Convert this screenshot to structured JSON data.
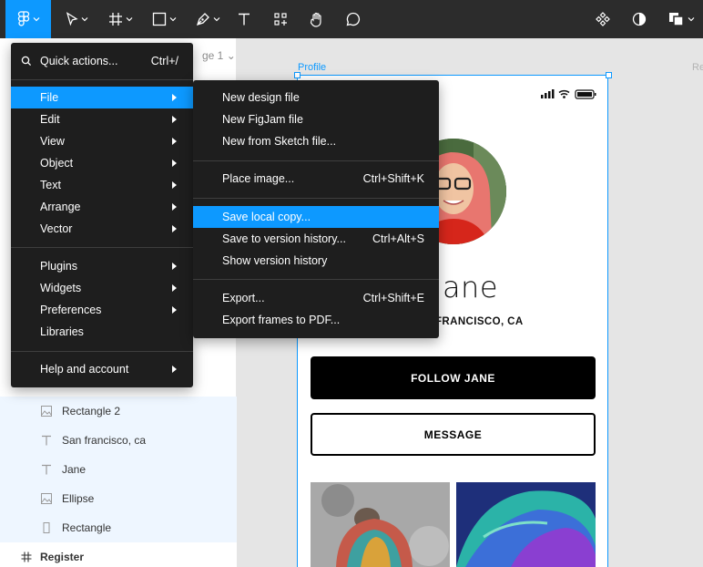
{
  "toolbar": {
    "tools": [
      "main-menu",
      "move",
      "frame",
      "shape",
      "pen",
      "text",
      "resources",
      "hand",
      "comment"
    ],
    "right_tools": [
      "components",
      "contrast",
      "multiplayer"
    ]
  },
  "page_tab": "ge 1",
  "canvas": {
    "frame_label": "Profile",
    "right_frame_label": "Re",
    "name": "Jane",
    "city": "FRANCISCO, CA",
    "follow_button": "FOLLOW JANE",
    "message_button": "MESSAGE"
  },
  "layers": [
    {
      "label": "Rectangle 2",
      "icon": "image-icon"
    },
    {
      "label": "San francisco, ca",
      "icon": "text-icon"
    },
    {
      "label": "Jane",
      "icon": "text-icon"
    },
    {
      "label": "Ellipse",
      "icon": "image-icon"
    },
    {
      "label": "Rectangle",
      "icon": "rect-icon"
    },
    {
      "label": "Register",
      "icon": "frame-icon"
    }
  ],
  "main_menu": {
    "quick_actions": {
      "label": "Quick actions...",
      "shortcut": "Ctrl+/"
    },
    "items": [
      {
        "label": "File",
        "submenu": true,
        "highlighted": true
      },
      {
        "label": "Edit",
        "submenu": true
      },
      {
        "label": "View",
        "submenu": true
      },
      {
        "label": "Object",
        "submenu": true
      },
      {
        "label": "Text",
        "submenu": true
      },
      {
        "label": "Arrange",
        "submenu": true
      },
      {
        "label": "Vector",
        "submenu": true
      },
      {
        "label": "Plugins",
        "submenu": true
      },
      {
        "label": "Widgets",
        "submenu": true
      },
      {
        "label": "Preferences",
        "submenu": true
      },
      {
        "label": "Libraries",
        "submenu": false
      },
      {
        "label": "Help and account",
        "submenu": true
      }
    ]
  },
  "file_menu": {
    "items": [
      {
        "label": "New design file",
        "shortcut": ""
      },
      {
        "label": "New FigJam file",
        "shortcut": ""
      },
      {
        "label": "New from Sketch file...",
        "shortcut": ""
      },
      {
        "label": "Place image...",
        "shortcut": "Ctrl+Shift+K"
      },
      {
        "label": "Save local copy...",
        "shortcut": "",
        "highlighted": true
      },
      {
        "label": "Save to version history...",
        "shortcut": "Ctrl+Alt+S"
      },
      {
        "label": "Show version history",
        "shortcut": ""
      },
      {
        "label": "Export...",
        "shortcut": "Ctrl+Shift+E"
      },
      {
        "label": "Export frames to PDF...",
        "shortcut": ""
      }
    ]
  },
  "colors": {
    "accent": "#0d99ff",
    "toolbar_bg": "#2c2c2c",
    "menu_bg": "#1e1e1e"
  }
}
